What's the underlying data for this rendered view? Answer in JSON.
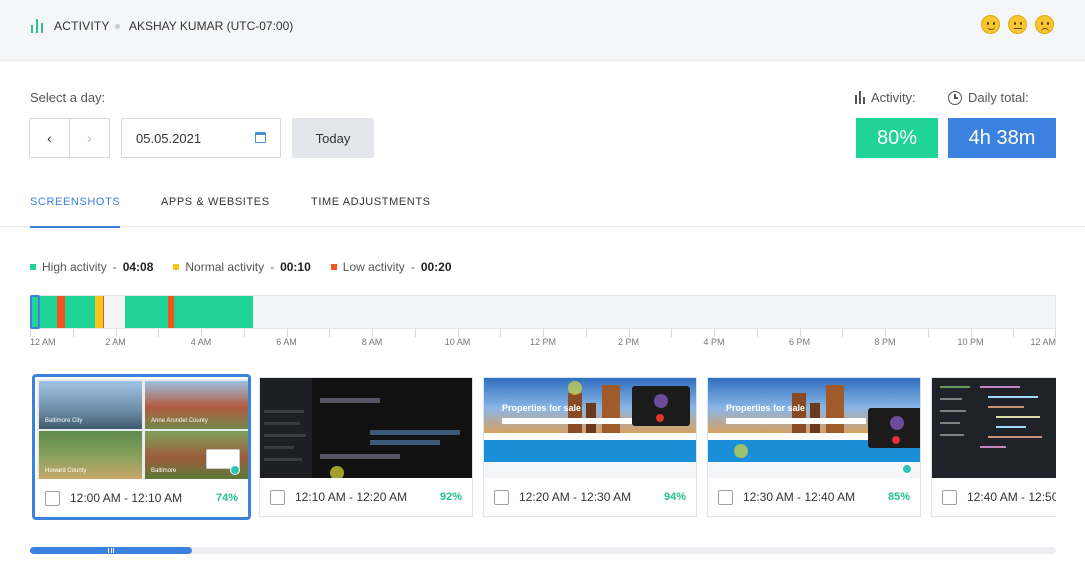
{
  "header": {
    "section": "ACTIVITY",
    "user": "AKSHAY KUMAR (UTC-07:00)",
    "icons": [
      "activity-bars-icon",
      "happy-face-icon",
      "neutral-face-icon",
      "sad-face-icon"
    ]
  },
  "day_selector": {
    "label": "Select a day:",
    "prev": "‹",
    "next": "›",
    "date": "05.05.2021",
    "today": "Today"
  },
  "stats": {
    "activity_label": "Activity:",
    "activity_value": "80%",
    "daily_label": "Daily total:",
    "daily_value": "4h 38m"
  },
  "tabs": [
    "SCREENSHOTS",
    "APPS & WEBSITES",
    "TIME ADJUSTMENTS"
  ],
  "active_tab": "SCREENSHOTS",
  "legend": [
    {
      "label": "High activity",
      "time": "04:08",
      "color": "#20d497"
    },
    {
      "label": "Normal activity",
      "time": "00:10",
      "color": "#f5c518"
    },
    {
      "label": "Low activity",
      "time": "00:20",
      "color": "#f0551e"
    }
  ],
  "timeline": {
    "range_hours": 24,
    "segments": [
      {
        "from": 0.0,
        "to": 0.6,
        "level": "high"
      },
      {
        "from": 0.6,
        "to": 0.8,
        "level": "low"
      },
      {
        "from": 0.8,
        "to": 1.5,
        "level": "high"
      },
      {
        "from": 1.5,
        "to": 1.68,
        "level": "normal"
      },
      {
        "from": 1.68,
        "to": 1.72,
        "level": "low"
      },
      {
        "from": 2.2,
        "to": 3.2,
        "level": "high"
      },
      {
        "from": 3.2,
        "to": 3.35,
        "level": "low"
      },
      {
        "from": 3.35,
        "to": 5.2,
        "level": "high"
      }
    ],
    "labels": [
      "12 AM",
      "2 AM",
      "4 AM",
      "6 AM",
      "8 AM",
      "10 AM",
      "12 PM",
      "2 PM",
      "4 PM",
      "6 PM",
      "8 PM",
      "10 PM",
      "12 AM"
    ]
  },
  "screenshots": [
    {
      "range": "12:00 AM - 12:10 AM",
      "activity": "74%",
      "selected": true,
      "captions": [
        "Baltimore City",
        "Anne Arundel County",
        "Howard County",
        "Baltimore"
      ]
    },
    {
      "range": "12:10 AM - 12:20 AM",
      "activity": "92%",
      "selected": false
    },
    {
      "range": "12:20 AM - 12:30 AM",
      "activity": "94%",
      "selected": false,
      "hero": "Properties for sale"
    },
    {
      "range": "12:30 AM - 12:40 AM",
      "activity": "85%",
      "selected": false,
      "hero": "Properties for sale"
    },
    {
      "range": "12:40 AM - 12:50",
      "activity": "",
      "selected": false
    }
  ],
  "scroll": {
    "position": 0.0
  }
}
